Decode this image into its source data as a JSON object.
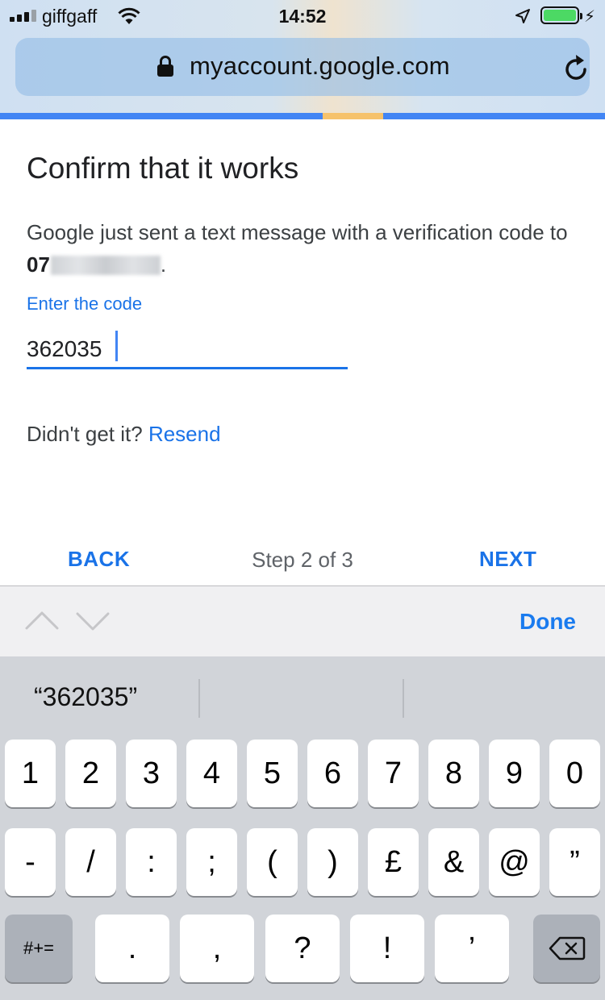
{
  "status_bar": {
    "carrier": "giffgaff",
    "time": "14:52"
  },
  "browser": {
    "url": "myaccount.google.com"
  },
  "page": {
    "title": "Confirm that it works",
    "message_text": "Google just sent a text message with a verification code to ",
    "phone_prefix": "07",
    "message_end": ".",
    "field_label": "Enter the code",
    "code_value": "362035",
    "resend_prompt": "Didn't get it? ",
    "resend_link": "Resend",
    "back_label": "BACK",
    "step_text": "Step 2 of 3",
    "next_label": "NEXT"
  },
  "accessory_bar": {
    "done_label": "Done"
  },
  "keyboard": {
    "prediction": "“362035”",
    "row1": [
      "1",
      "2",
      "3",
      "4",
      "5",
      "6",
      "7",
      "8",
      "9",
      "0"
    ],
    "row2": [
      "-",
      "/",
      ":",
      ";",
      "(",
      ")",
      "£",
      "&",
      "@",
      "”"
    ],
    "row3_symbols_key": "#+=",
    "row3": [
      ".",
      ",",
      "?",
      "!",
      "’"
    ]
  },
  "colors": {
    "link_blue": "#1a73e8",
    "battery_green": "#4cd964",
    "ios_done_blue": "#1a7bef"
  }
}
